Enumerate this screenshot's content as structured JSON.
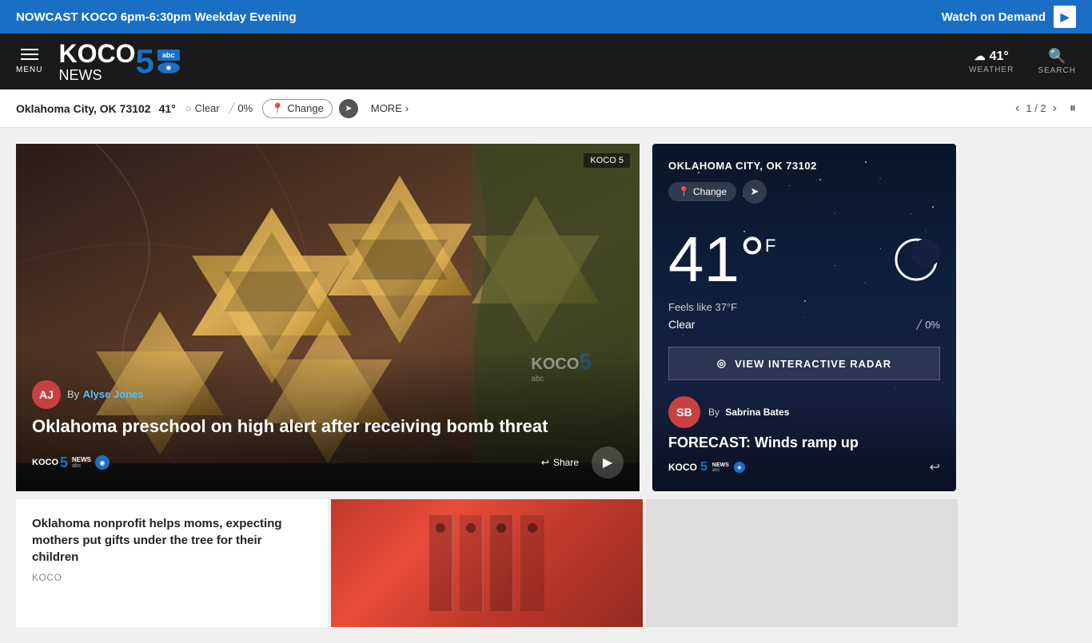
{
  "topBanner": {
    "text": "NOWCAST KOCO 6pm-6:30pm Weekday Evening",
    "watchLabel": "Watch on Demand",
    "playIcon": "▶"
  },
  "header": {
    "menuLabel": "MENU",
    "logoKoco": "KOCO",
    "logoNews": "NEWS",
    "logo5": "5",
    "logoAbc": "abc",
    "weatherTemp": "41°",
    "weatherLabel": "WEATHER",
    "searchLabel": "SEARCH"
  },
  "weatherBar": {
    "location": "Oklahoma City, OK 73102",
    "temp": "41°",
    "conditionIcon": "○",
    "condition": "Clear",
    "precipIcon": "╱",
    "precip": "0%",
    "changeLabel": "Change",
    "changeIcon": "📍",
    "locateIcon": "➤",
    "moreLabel": "MORE",
    "moreIcon": "›",
    "pages": "1 / 2",
    "prevIcon": "‹",
    "nextIcon": "›",
    "pauseIcon": "⏸"
  },
  "featuredVideo": {
    "badge": "KOCO 5",
    "authorLabel": "By",
    "authorName": "Alyse Jones",
    "title": "Oklahoma preschool on high alert after receiving bomb threat",
    "shareLabel": "Share",
    "playIcon": "▶"
  },
  "weatherWidget": {
    "location": "OKLAHOMA CITY, OK 73102",
    "changeLabel": "Change",
    "locateIcon": "➤",
    "temp": "41°",
    "unit": "F",
    "feelsLike": "Feels like 37°F",
    "condition": "Clear",
    "precip": "0%",
    "precipIcon": "╱",
    "radarLabel": "VIEW INTERACTIVE RADAR",
    "radarIcon": "◎",
    "authorLabel": "By",
    "authorName": "Sabrina Bates",
    "forecastTitle": "FORECAST: Winds ramp up",
    "shareIcon": "↩"
  },
  "bottomCards": [
    {
      "title": "Oklahoma nonprofit helps moms, expecting mothers put gifts under the tree for their children",
      "source": "KOCO"
    },
    {
      "title": "",
      "source": ""
    },
    {
      "title": "",
      "source": ""
    }
  ],
  "colors": {
    "bannerBg": "#1a6fc4",
    "headerBg": "#1a1a1a",
    "accentBlue": "#1a6fc4",
    "weatherDark": "#0a1628"
  }
}
